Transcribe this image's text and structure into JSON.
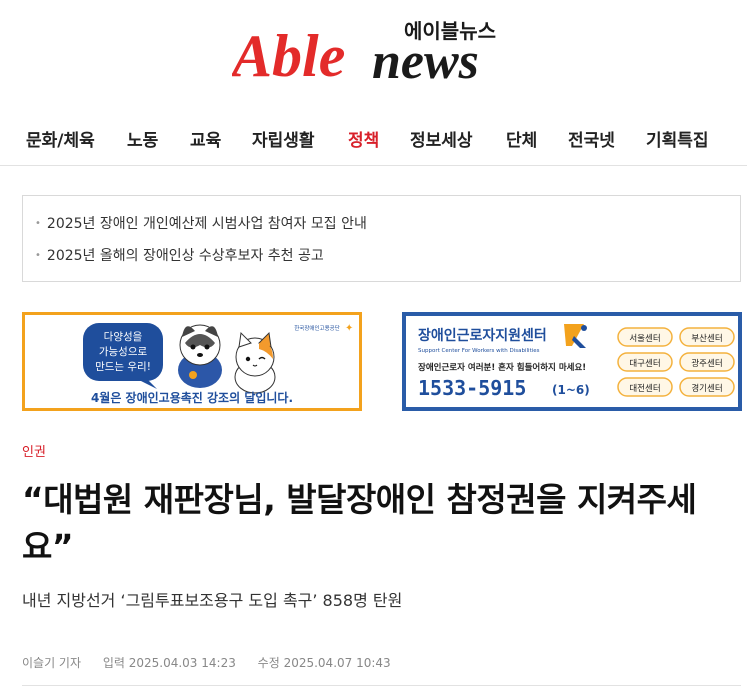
{
  "logo": {
    "wordmark_able": "Able",
    "wordmark_news": "news",
    "korean_name": "에이블뉴스",
    "colors": {
      "able": "#e32b2a",
      "news": "#1a1a1a"
    }
  },
  "nav": {
    "items": [
      {
        "label": "문화/체육",
        "active": false
      },
      {
        "label": "노동",
        "active": false
      },
      {
        "label": "교육",
        "active": false
      },
      {
        "label": "자립생활",
        "active": false
      },
      {
        "label": "정책",
        "active": true
      },
      {
        "label": "정보세상",
        "active": false
      },
      {
        "label": "단체",
        "active": false
      },
      {
        "label": "전국넷",
        "active": false
      },
      {
        "label": "기획특집",
        "active": false
      }
    ],
    "active_color": "#d8202a"
  },
  "notices": [
    {
      "text": "2025년 장애인 개인예산제 시범사업 참여자 모집 안내"
    },
    {
      "text": "2025년 올해의 장애인상 수상후보자 추천 공고"
    }
  ],
  "banner1": {
    "bubble_text": [
      "다양성을",
      "가능성으로",
      "만드는 우리!"
    ],
    "org_name": "한국장애인고용공단",
    "caption": "4월은 장애인고용촉진 강조의 달입니다.",
    "colors": {
      "border": "#f3a21d",
      "bubble": "#1f4e9c",
      "caption": "#1f4e9c"
    }
  },
  "banner2": {
    "title": "장애인근로자지원센터",
    "subtitle": "Support Center For Workers with Disabilities",
    "message": "장애인근로자 여러분! 혼자 힘들어하지 마세요!",
    "phone": "1533-5915",
    "phone_suffix": "(1~6)",
    "centers": [
      "서울센터",
      "부산센터",
      "대구센터",
      "광주센터",
      "대전센터",
      "경기센터"
    ],
    "colors": {
      "border": "#2a5ca8",
      "title": "#1f4e9c",
      "button": "#f4b23e"
    }
  },
  "article": {
    "category": "인권",
    "headline": "“대법원 재판장님, 발달장애인 참정권을 지켜주세요”",
    "subheadline": "내년 지방선거 ‘그림투표보조용구 도입 촉구’ 858명 탄원",
    "reporter": "이슬기 기자",
    "published": "입력 2025.04.03 14:23",
    "modified": "수정 2025.04.07 10:43"
  }
}
